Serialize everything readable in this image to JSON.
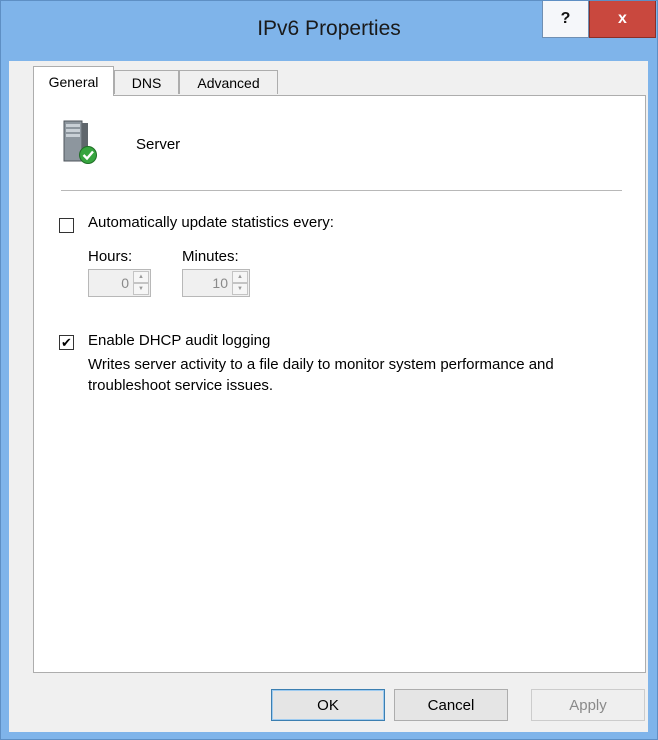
{
  "window": {
    "title": "IPv6 Properties",
    "help_label": "?",
    "close_label": "x"
  },
  "tabs": [
    {
      "label": "General",
      "selected": true
    },
    {
      "label": "DNS",
      "selected": false
    },
    {
      "label": "Advanced",
      "selected": false
    }
  ],
  "general": {
    "server_name": "Server",
    "auto_update": {
      "label": "Automatically update statistics every:",
      "checked": false
    },
    "hours": {
      "label": "Hours:",
      "value": "0",
      "disabled": true
    },
    "minutes": {
      "label": "Minutes:",
      "value": "10",
      "disabled": true
    },
    "dhcp_audit": {
      "label": "Enable DHCP audit logging",
      "checked": true,
      "description": "Writes server activity to a file daily to monitor system performance and troubleshoot service issues."
    }
  },
  "buttons": {
    "ok": "OK",
    "cancel": "Cancel",
    "apply": "Apply",
    "apply_disabled": true
  },
  "glyphs": {
    "check": "✔",
    "up": "▲",
    "down": "▼"
  },
  "colors": {
    "titlebar": "#7fb4ea",
    "close": "#c9483e",
    "dialog": "#f0f0f0",
    "panel": "#ffffff"
  }
}
